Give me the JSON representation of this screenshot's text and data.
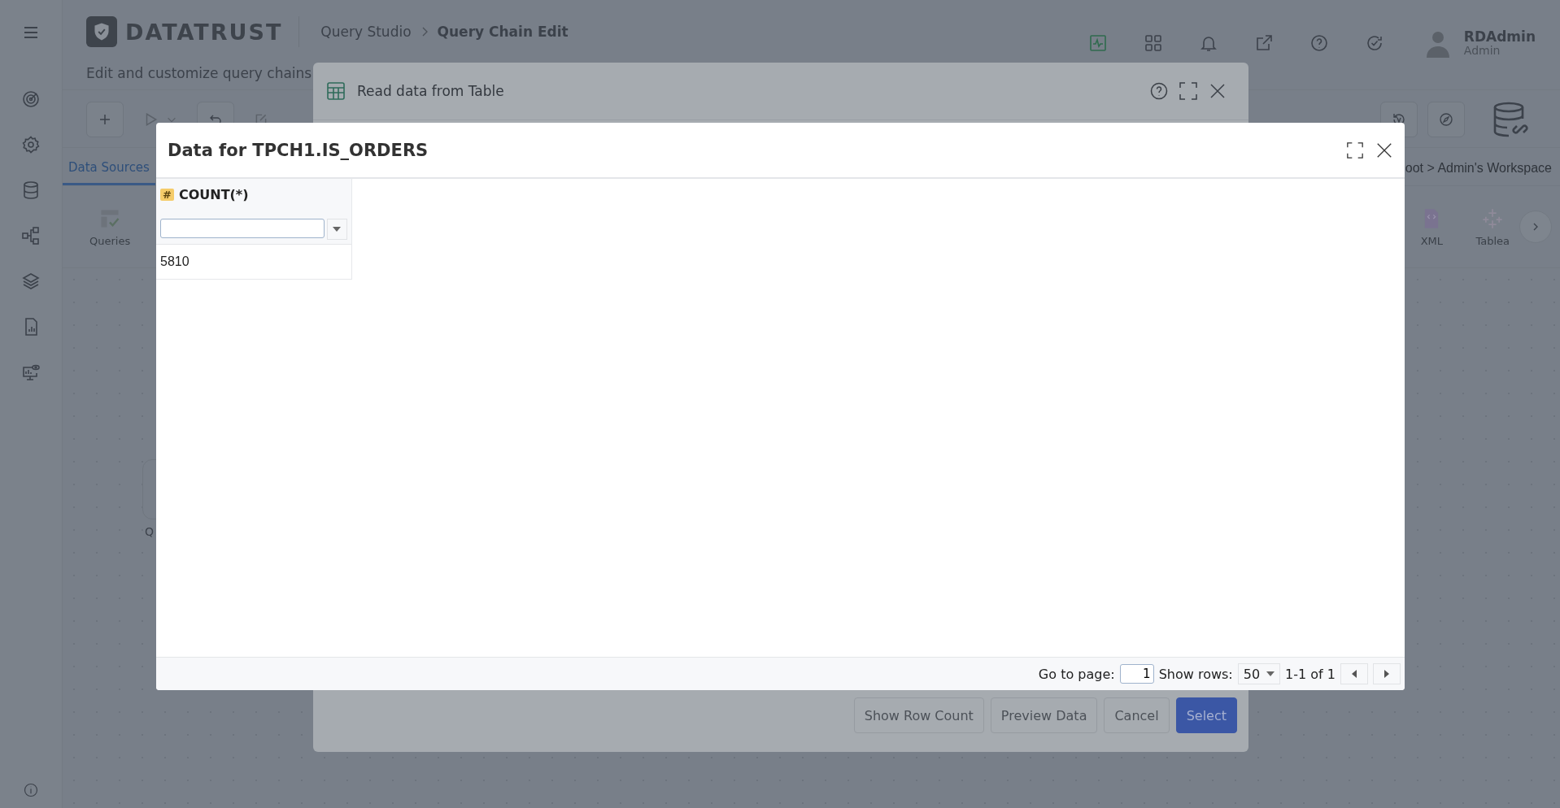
{
  "header": {
    "logo": "DATATRUST",
    "breadcrumbs": [
      "Query Studio",
      "Query Chain Edit"
    ],
    "user": {
      "name": "RDAdmin",
      "role": "Admin"
    }
  },
  "subtitle": "Edit and customize query chains",
  "tabs": [
    {
      "label": "Data Sources",
      "selected": true
    }
  ],
  "workspace_path": "oot > Admin's Workspace",
  "source_items": [
    {
      "label": "Queries",
      "kind": "queries"
    },
    {
      "label": "XML",
      "kind": "xml"
    },
    {
      "label": "Tablea",
      "kind": "tableau"
    }
  ],
  "canvas_node": {
    "label": "Q"
  },
  "read_dialog": {
    "title": "Read data from Table",
    "buttons": [
      {
        "label": "Show Row Count",
        "kind": "default"
      },
      {
        "label": "Preview Data",
        "kind": "default"
      },
      {
        "label": "Cancel",
        "kind": "default"
      },
      {
        "label": "Select",
        "kind": "primary"
      }
    ]
  },
  "data_dialog": {
    "title": "Data for TPCH1.IS_ORDERS",
    "columns": [
      {
        "name": "COUNT(*)",
        "type_icon": "#"
      }
    ],
    "rows": [
      [
        "5810"
      ]
    ],
    "pager": {
      "goto_label": "Go to page:",
      "page": "1",
      "rows_label": "Show rows:",
      "rows_value": "50",
      "range": "1-1 of 1"
    }
  }
}
